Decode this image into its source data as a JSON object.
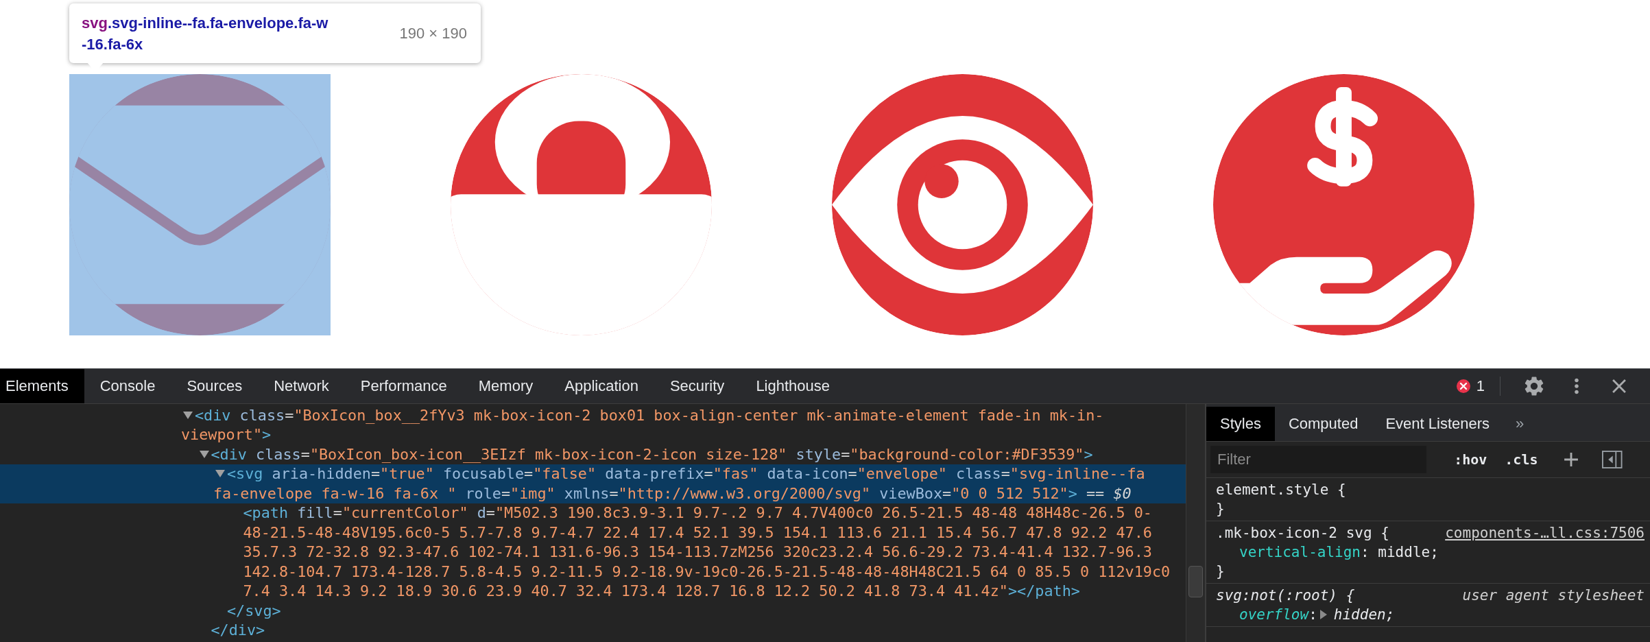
{
  "tooltip": {
    "tag": "svg",
    "selector_lines": [
      ".svg-inline--fa.fa-envelope.fa-w",
      "-16.fa-6x"
    ],
    "size": "190 × 190"
  },
  "icons": [
    {
      "kind": "envelope",
      "highlighted": true
    },
    {
      "kind": "lock",
      "highlighted": false
    },
    {
      "kind": "eye",
      "highlighted": false
    },
    {
      "kind": "hand-dollar",
      "highlighted": false
    }
  ],
  "devtools": {
    "tabs": [
      {
        "label": "Elements",
        "selected": true
      },
      {
        "label": "Console",
        "selected": false
      },
      {
        "label": "Sources",
        "selected": false
      },
      {
        "label": "Network",
        "selected": false
      },
      {
        "label": "Performance",
        "selected": false
      },
      {
        "label": "Memory",
        "selected": false
      },
      {
        "label": "Application",
        "selected": false
      },
      {
        "label": "Security",
        "selected": false
      },
      {
        "label": "Lighthouse",
        "selected": false
      }
    ],
    "error_count": "1",
    "tree": [
      {
        "expanded": true,
        "selected": false,
        "lines": [
          [
            {
              "kind": "tag",
              "text": "<div"
            },
            {
              "kind": "attr",
              "text": " class"
            },
            {
              "kind": "eq",
              "text": "="
            },
            {
              "kind": "value",
              "text": "\"BoxIcon_box__2fYv3 mk-box-icon-2 box01 box-align-center mk-animate-element fade-in mk-in-"
            }
          ],
          [
            {
              "kind": "value",
              "text": "viewport\""
            },
            {
              "kind": "tag",
              "text": ">"
            }
          ]
        ],
        "children": [
          {
            "expanded": true,
            "selected": false,
            "lines": [
              [
                {
                  "kind": "tag",
                  "text": "<div"
                },
                {
                  "kind": "attr",
                  "text": " class"
                },
                {
                  "kind": "eq",
                  "text": "="
                },
                {
                  "kind": "value",
                  "text": "\"BoxIcon_box-icon__3EIzf mk-box-icon-2-icon size-128\""
                },
                {
                  "kind": "attr",
                  "text": " style"
                },
                {
                  "kind": "eq",
                  "text": "="
                },
                {
                  "kind": "value",
                  "text": "\"background-color:#DF3539\""
                },
                {
                  "kind": "tag",
                  "text": ">"
                }
              ]
            ],
            "children": [
              {
                "expanded": true,
                "selected": true,
                "lines": [
                  [
                    {
                      "kind": "tag",
                      "text": "<svg"
                    },
                    {
                      "kind": "attr",
                      "text": " aria-hidden"
                    },
                    {
                      "kind": "eq",
                      "text": "="
                    },
                    {
                      "kind": "value",
                      "text": "\"true\""
                    },
                    {
                      "kind": "attr",
                      "text": " focusable"
                    },
                    {
                      "kind": "eq",
                      "text": "="
                    },
                    {
                      "kind": "value",
                      "text": "\"false\""
                    },
                    {
                      "kind": "attr",
                      "text": " data-prefix"
                    },
                    {
                      "kind": "eq",
                      "text": "="
                    },
                    {
                      "kind": "value",
                      "text": "\"fas\""
                    },
                    {
                      "kind": "attr",
                      "text": " data-icon"
                    },
                    {
                      "kind": "eq",
                      "text": "="
                    },
                    {
                      "kind": "value",
                      "text": "\"envelope\""
                    },
                    {
                      "kind": "attr",
                      "text": " class"
                    },
                    {
                      "kind": "eq",
                      "text": "="
                    },
                    {
                      "kind": "value",
                      "text": "\"svg-inline--fa"
                    }
                  ],
                  [
                    {
                      "kind": "value",
                      "text": "fa-envelope fa-w-16 fa-6x \""
                    },
                    {
                      "kind": "attr",
                      "text": " role"
                    },
                    {
                      "kind": "eq",
                      "text": "="
                    },
                    {
                      "kind": "value",
                      "text": "\"img\""
                    },
                    {
                      "kind": "attr",
                      "text": " xmlns"
                    },
                    {
                      "kind": "eq",
                      "text": "="
                    },
                    {
                      "kind": "value",
                      "text": "\"http://www.w3.org/2000/svg\""
                    },
                    {
                      "kind": "attr",
                      "text": " viewBox"
                    },
                    {
                      "kind": "eq",
                      "text": "="
                    },
                    {
                      "kind": "value",
                      "text": "\"0 0 512 512\""
                    },
                    {
                      "kind": "tag",
                      "text": ">"
                    },
                    {
                      "kind": "note",
                      "text": " == "
                    },
                    {
                      "kind": "var",
                      "text": "$0"
                    }
                  ]
                ],
                "children": [
                  {
                    "selected": false,
                    "lines": [
                      [
                        {
                          "kind": "tag",
                          "text": "<path"
                        },
                        {
                          "kind": "attr",
                          "text": " fill"
                        },
                        {
                          "kind": "eq",
                          "text": "="
                        },
                        {
                          "kind": "value",
                          "text": "\"currentColor\""
                        },
                        {
                          "kind": "attr",
                          "text": " d"
                        },
                        {
                          "kind": "eq",
                          "text": "="
                        },
                        {
                          "kind": "value",
                          "text": "\"M502.3 190.8c3.9-3.1 9.7-.2 9.7 4.7V400c0 26.5-21.5 48-48 48H48c-26.5 0-"
                        }
                      ],
                      [
                        {
                          "kind": "value",
                          "text": "48-21.5-48-48V195.6c0-5 5.7-7.8 9.7-4.7 22.4 17.4 52.1 39.5 154.1 113.6 21.1 15.4 56.7 47.8 92.2 47.6"
                        }
                      ],
                      [
                        {
                          "kind": "value",
                          "text": "35.7.3 72-32.8 92.3-47.6 102-74.1 131.6-96.3 154-113.7zM256 320c23.2.4 56.6-29.2 73.4-41.4 132.7-96.3"
                        }
                      ],
                      [
                        {
                          "kind": "value",
                          "text": "142.8-104.7 173.4-128.7 5.8-4.5 9.2-11.5 9.2-18.9v-19c0-26.5-21.5-48-48-48H48C21.5 64 0 85.5 0 112v19c0"
                        }
                      ],
                      [
                        {
                          "kind": "value",
                          "text": "7.4 3.4 14.3 9.2 18.9 30.6 23.9 40.7 32.4 173.4 128.7 16.8 12.2 50.2 41.8 73.4 41.4z\""
                        },
                        {
                          "kind": "tag",
                          "text": "></path>"
                        }
                      ]
                    ]
                  }
                ],
                "closing": "</svg>"
              }
            ],
            "closing": "</div>"
          }
        ]
      }
    ],
    "styles": {
      "tabs": [
        {
          "label": "Styles",
          "selected": true
        },
        {
          "label": "Computed",
          "selected": false
        },
        {
          "label": "Event Listeners",
          "selected": false
        }
      ],
      "more": "»",
      "filter_placeholder": "Filter",
      "toggles": [
        ":hov",
        ".cls"
      ],
      "rules": [
        {
          "kind": "inline",
          "selector": "element.style {",
          "close": "}"
        },
        {
          "kind": "author",
          "selector": ".mk-box-icon-2 svg {",
          "source": "components-…ll.css:7506",
          "declarations": [
            {
              "property": "vertical-align",
              "colon": ":",
              "value": "middle;",
              "expandable": false
            }
          ],
          "close": "}"
        },
        {
          "kind": "user-agent",
          "selector": "svg:not(:root) {",
          "source": "user agent stylesheet",
          "declarations": [
            {
              "property": "overflow",
              "colon": ":",
              "value": "hidden;",
              "expandable": true
            }
          ]
        }
      ]
    }
  }
}
